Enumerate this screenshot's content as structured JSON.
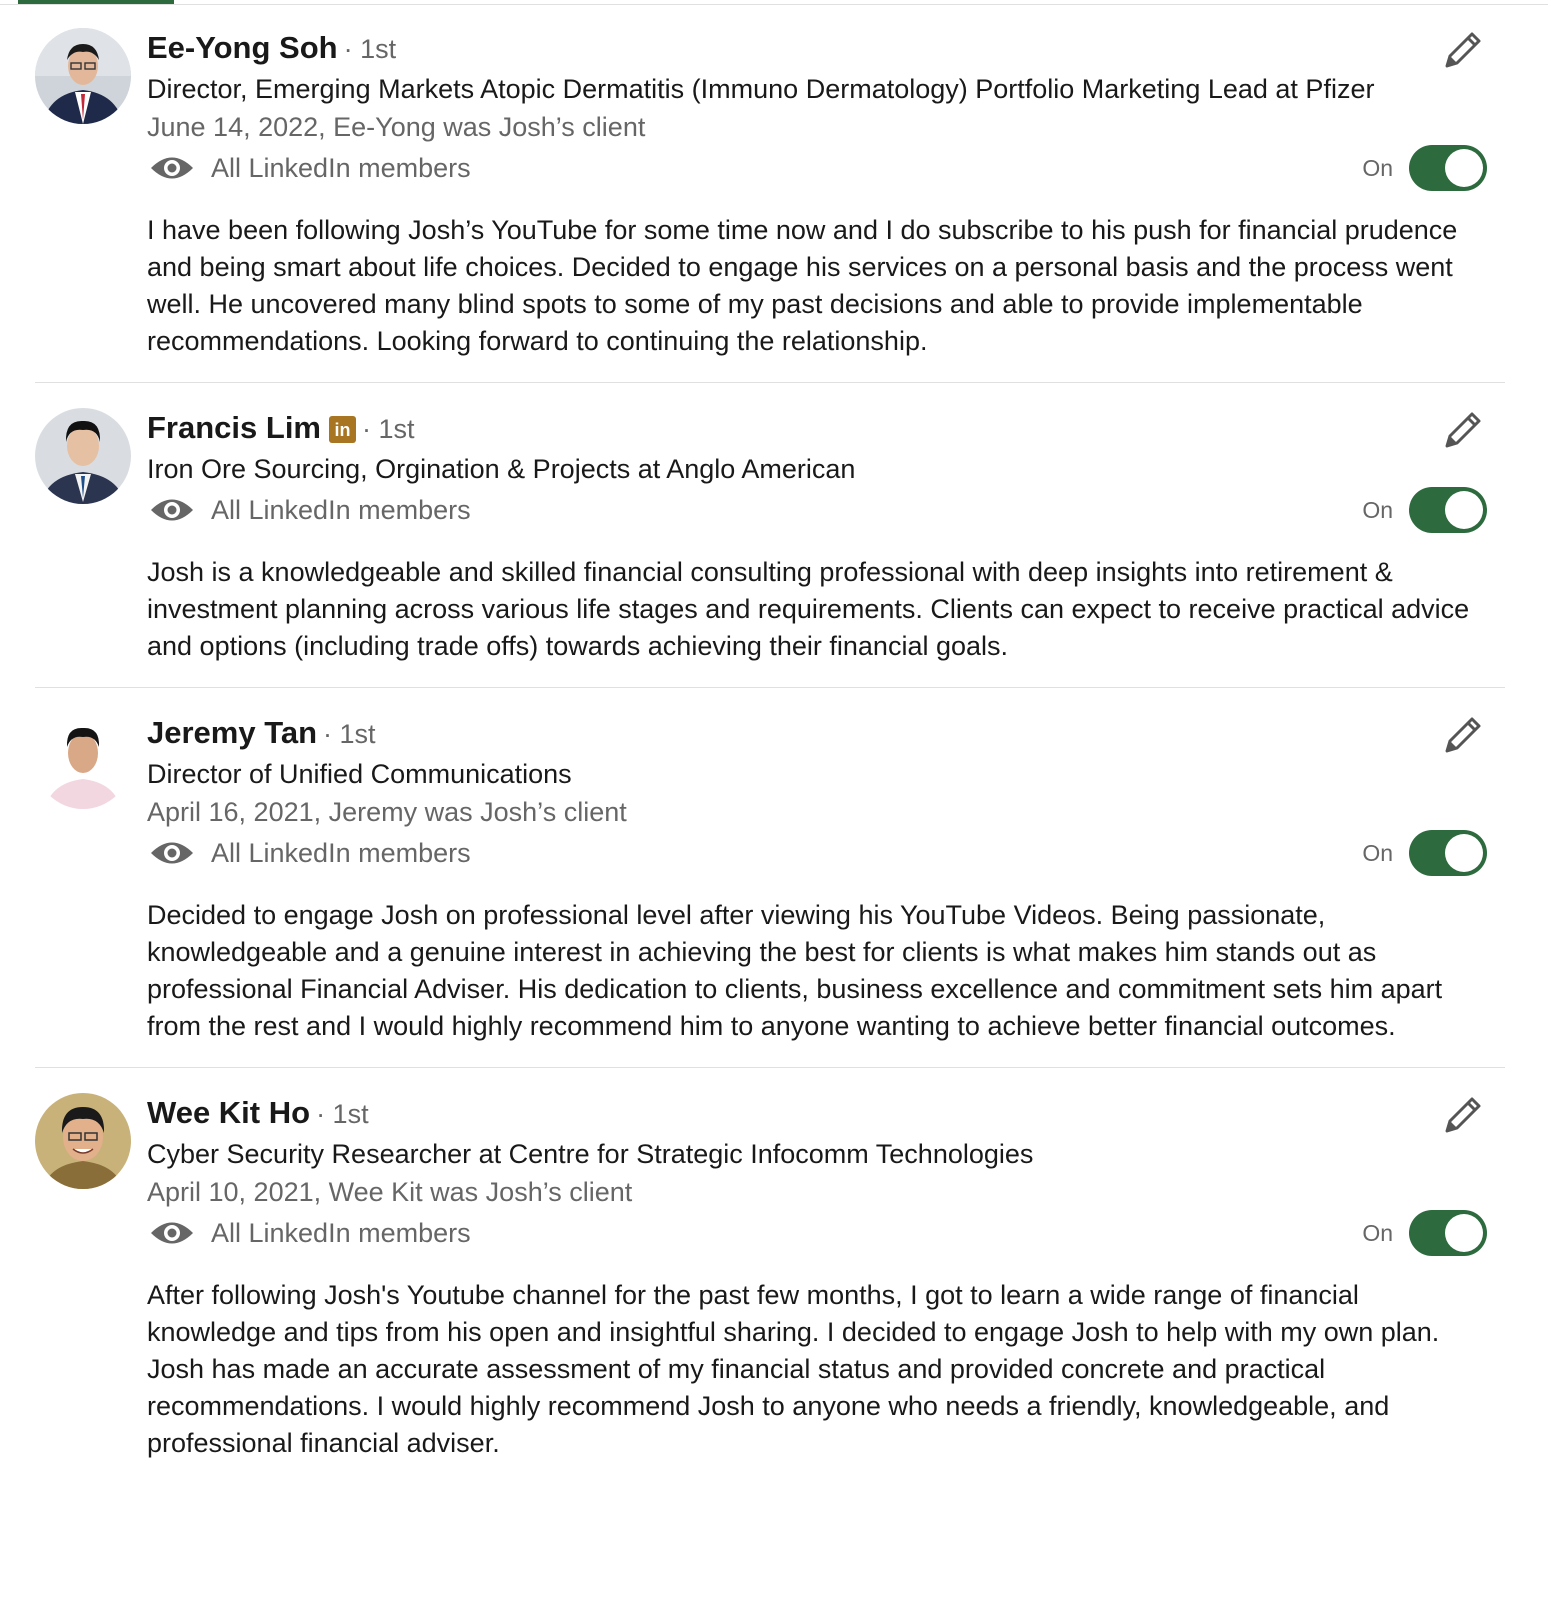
{
  "colors": {
    "accent": "#2d6a3e",
    "badge": "#a87522",
    "secondary_text": "#666666"
  },
  "recommendations": [
    {
      "name": "Ee-Yong Soh",
      "degree": "· 1st",
      "headline": "Director, Emerging Markets Atopic Dermatitis (Immuno Dermatology) Portfolio Marketing Lead at Pfizer",
      "meta": "June 14, 2022, Ee-Yong was Josh’s client",
      "visibility": "All LinkedIn members",
      "toggle_label": "On",
      "toggle_on": true,
      "text": "I have been following Josh’s YouTube for some time now and I do subscribe to his push for financial prudence and being smart about life choices. Decided to engage his services on a personal basis and the process went well. He uncovered many blind spots to some of my past decisions and able to provide implementable recommendations. Looking forward to continuing the relationship."
    },
    {
      "name": "Francis Lim",
      "badge": "in",
      "degree": "· 1st",
      "headline": "Iron Ore Sourcing, Orgination & Projects at Anglo American",
      "visibility": "All LinkedIn members",
      "toggle_label": "On",
      "toggle_on": true,
      "text": "Josh is a knowledgeable and skilled financial consulting professional with deep insights into retirement & investment planning across various life stages and requirements. Clients can expect to receive practical advice and options (including trade offs) towards achieving their financial goals."
    },
    {
      "name": "Jeremy Tan",
      "degree": "· 1st",
      "headline": "Director of Unified Communications",
      "meta": "April 16, 2021, Jeremy was Josh’s client",
      "visibility": "All LinkedIn members",
      "toggle_label": "On",
      "toggle_on": true,
      "text": "Decided to engage Josh on professional level after viewing his YouTube Videos. Being passionate, knowledgeable and a genuine interest in achieving the best for clients is what makes him stands out as professional Financial Adviser. His dedication to clients, business excellence and commitment sets him apart from the rest and I would highly recommend him to anyone wanting to achieve better financial outcomes."
    },
    {
      "name": "Wee Kit Ho",
      "degree": "· 1st",
      "headline": "Cyber Security Researcher at Centre for Strategic Infocomm Technologies",
      "meta": "April 10, 2021, Wee Kit was Josh’s client",
      "visibility": "All LinkedIn members",
      "toggle_label": "On",
      "toggle_on": true,
      "text": "After following Josh's Youtube channel for the past few months, I got to learn a wide range of financial knowledge and tips from his open and insightful sharing. I decided to engage Josh to help with my own plan. Josh has made an accurate assessment of my financial status and provided concrete and practical recommendations. I would highly recommend Josh to anyone who needs a friendly, knowledgeable, and professional financial adviser."
    }
  ]
}
